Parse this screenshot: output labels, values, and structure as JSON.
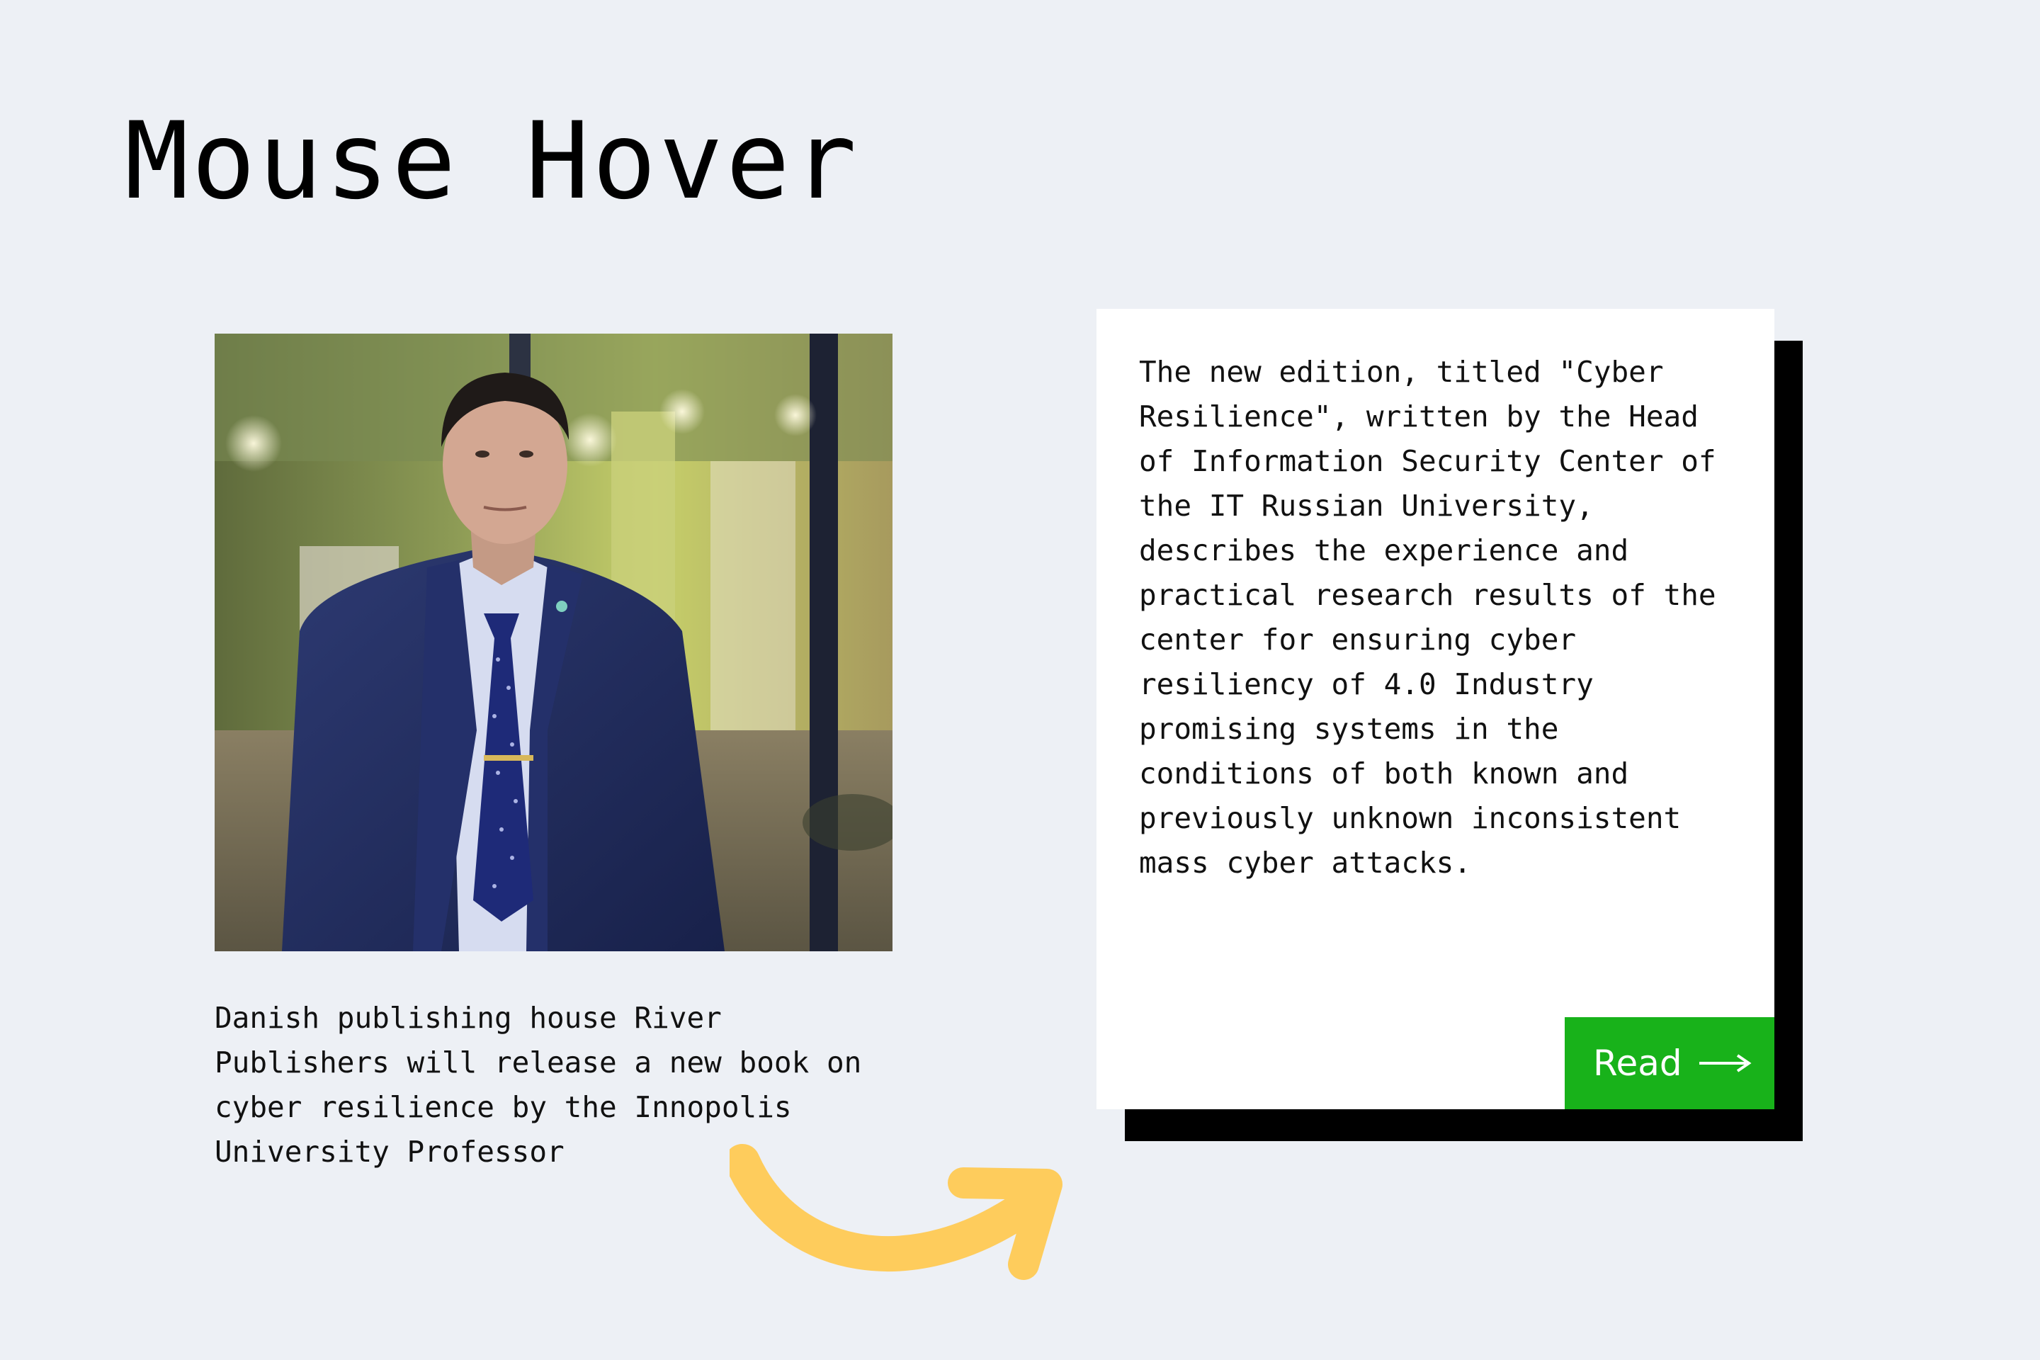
{
  "page": {
    "title": "Mouse Hover"
  },
  "teaser": {
    "text": "Danish publishing house River Publishers will release a new book on cyber resilience by the Innopolis University Professor"
  },
  "card": {
    "text": "The new edition, titled \"Cyber\nResilience\", written by the Head\nof Information Security Center of\nthe IT Russian University,\ndescribes the experience and\npractical research results of the\ncenter for ensuring cyber\nresiliency of 4.0 Industry\npromising systems in the\nconditions of both known and\npreviously unknown inconsistent\nmass cyber attacks.",
    "button_label": "Read",
    "button_icon": "arrow-right-icon"
  },
  "colors": {
    "background": "#edf0f5",
    "card": "#ffffff",
    "card_shadow": "#000000",
    "button": "#18b21a",
    "curved_arrow": "#fecc5c"
  }
}
